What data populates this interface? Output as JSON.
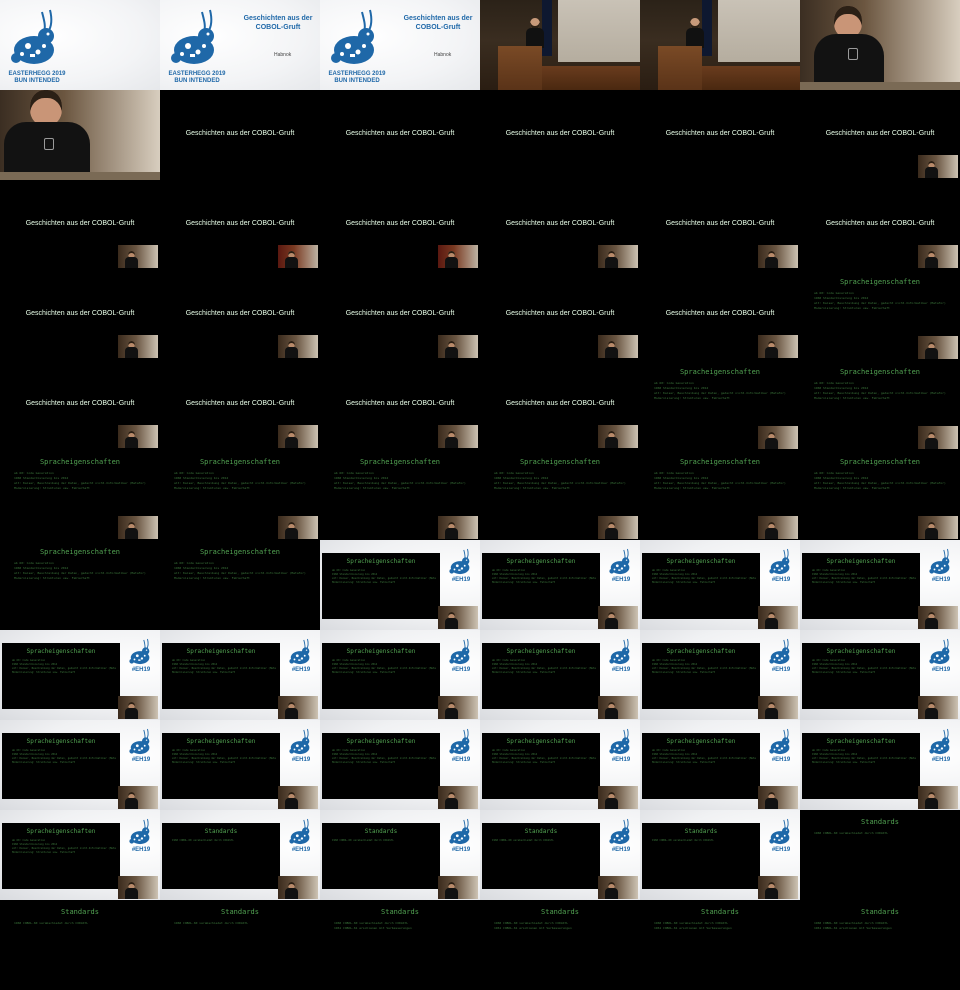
{
  "intro": {
    "event_line1": "EASTERHEGG 2019",
    "event_line2": "BUN INTENDED",
    "talk_title": "Geschichten aus der COBOL-Gruft",
    "speaker": "Habnok"
  },
  "slides": {
    "title_black": "Geschichten aus der COBOL-Gruft",
    "sprach": {
      "heading": "Spracheigenschaften",
      "lines": [
        "ab 60: Code Generation",
        "1960 Standardisierung bis 2014",
        "alt: Kaiser, Beschreibung der Daten, gedacht nicht-Informatiker (Metafor)",
        "Modernisierung: Strukturen usw. Fehlerhaft"
      ]
    },
    "std": {
      "heading": "Standards",
      "lines_one": [
        "1960    COBOL-60 verabschiedet durch CODASYL"
      ],
      "lines_two": [
        "1960    COBOL-60 verabschiedet durch CODASYL",
        "1961    COBOL-61 erschienen mit Verbesserungen"
      ]
    },
    "eh_tag": "#EH19"
  },
  "icons": {
    "bunny": "bunny-logo-icon"
  },
  "colors": {
    "brand_blue": "#1f68a8",
    "terminal_green": "#52a352",
    "title_text": "#e8ffe8"
  }
}
